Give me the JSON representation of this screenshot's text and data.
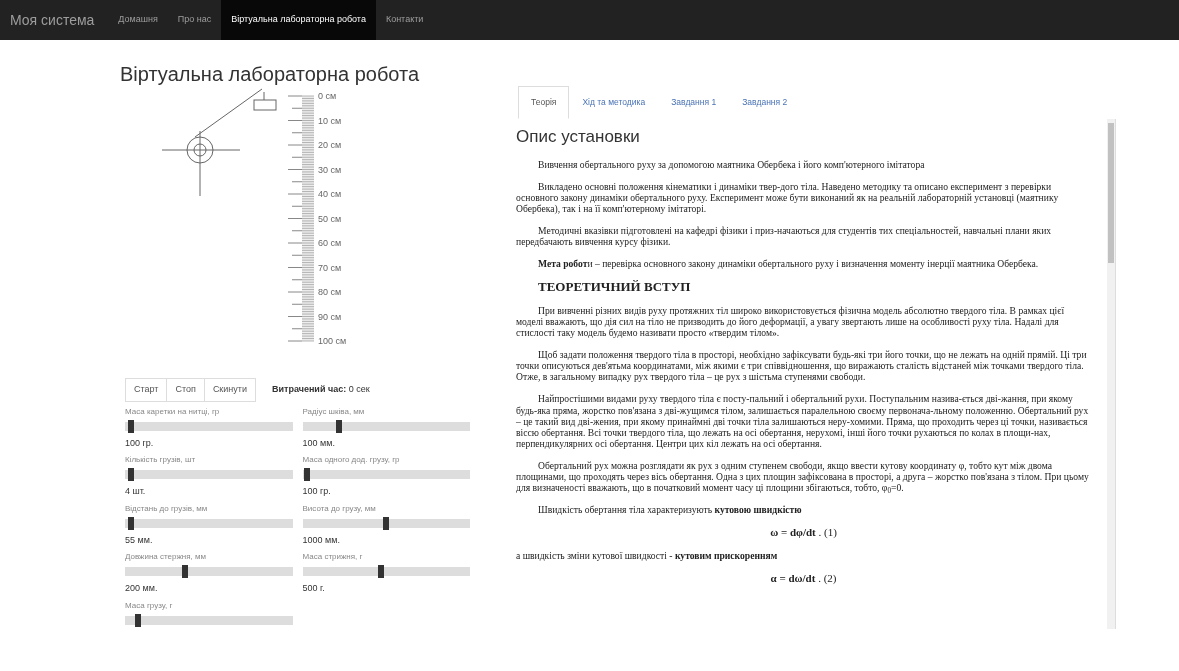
{
  "navbar": {
    "brand": "Моя система",
    "items": [
      {
        "label": "Домашня",
        "selected": false
      },
      {
        "label": "Про нас",
        "selected": false
      },
      {
        "label": "Віртуальна лабораторна робота",
        "selected": true
      },
      {
        "label": "Контакти",
        "selected": false
      }
    ]
  },
  "page_title": "Віртуальна лабораторна робота",
  "ruler": {
    "labels": [
      "0 см",
      "10 см",
      "20 см",
      "30 см",
      "40 см",
      "50 см",
      "60 см",
      "70 см",
      "80 см",
      "90 см",
      "100 см"
    ]
  },
  "controls": {
    "buttons": [
      "Старт",
      "Стоп",
      "Скинути"
    ],
    "time_label": "Витрачений час:",
    "time_value": "0 сек"
  },
  "sliders": [
    {
      "label": "Маса каретки на нитці, гр",
      "level": 0.02,
      "reading": "100 гр."
    },
    {
      "label": "Радіус шківа, мм",
      "level": 0.2,
      "reading": "100 мм."
    },
    {
      "label": "Кількість грузів, шт",
      "level": 0.02,
      "reading": "4 шт."
    },
    {
      "label": "Маса одного дод. грузу, гр",
      "level": 0.01,
      "reading": "100 гр."
    },
    {
      "label": "Відстань до грузів, мм",
      "level": 0.02,
      "reading": "55 мм."
    },
    {
      "label": "Висота до грузу, мм",
      "level": 0.48,
      "reading": "1000 мм."
    },
    {
      "label": "Довжина стержня, мм",
      "level": 0.34,
      "reading": "200 мм."
    },
    {
      "label": "Маса стрижня, г",
      "level": 0.45,
      "reading": "500 г."
    },
    {
      "label": "Маса грузу, г",
      "level": 0.06
    }
  ],
  "tabs": [
    {
      "label": "Теорія",
      "selected": true
    },
    {
      "label": "Хід та методика",
      "selected": false
    },
    {
      "label": "Завдання 1",
      "selected": false
    },
    {
      "label": "Завдання 2",
      "selected": false
    }
  ],
  "content": {
    "heading": "Опис установки",
    "blocks": [
      {
        "kind": "para",
        "text": "Вивчення обертального руху за допомогою маятника Обербека і його комп'ютерного імітатора"
      },
      {
        "kind": "para",
        "text": "Викладено основні положення кінематики і динаміки твер-дого тіла. Наведено методику та описано експеримент з перевірки основного закону динаміки обертального руху. Експеримент може бути виконаний як на реальній лабораторній установці (маятнику Обербека), так і на її комп'ютерному імітаторі."
      },
      {
        "kind": "para",
        "text": "Методичні вказівки підготовлені на кафедрі фізики і приз-начаються для студентів тих спеціальностей, навчальні плани яких передбачають вивчення курсу фізики."
      },
      {
        "kind": "para",
        "text": "**Мета робот**и – перевірка основного закону динаміки обертального руху і визначення моменту інерції маятника Обербека."
      },
      {
        "kind": "heading",
        "text": "ТЕОРЕТИЧНИЙ ВСТУП"
      },
      {
        "kind": "para",
        "text": "При вивченні різних видів руху протяжних тіл широко використовується фізична модель абсолютно твердого тіла. В рамках цієї моделі вважають, що дія сил на тіло не призводить до його деформації, а увагу звертають лише на особливості руху тіла. Надалі для стислості таку модель будемо називати просто «твердим тілом»."
      },
      {
        "kind": "para",
        "text": "Щоб задати положення твердого тіла в просторі, необхідно зафіксувати будь-які три його точки, що не лежать на одній прямій. Ці три точки описуються дев'ятьма координатами, між якими є три співвідношення, що виражають сталість відстаней між точками твердого тіла. Отже, в загальному випадку рух твердого тіла – це рух з шістьма ступенями свободи."
      },
      {
        "kind": "para",
        "text": "Найпростішими видами руху твердого тіла є посту-пальний і обертальний рухи. Поступальним назива-ється дві-жання, при якому будь-яка пряма, жорстко пов'язана з дві-жущимся тілом, залишається паралельною своєму первонача-льному положенню. Обертальний рух – це такий вид дві-жения, при якому принаймні дві точки тіла залишаються неру-хомими. Пряма, що проходить через ці точки, називається віссю обертання. Всі точки твердого тіла, що лежать на осі обертання, нерухомі, інші його точки рухаються по колах в площи-нах, перпендикулярних осі обертання. Центри цих кіл лежать на осі обертання."
      },
      {
        "kind": "para",
        "text": "Обертальний рух можна розглядати як рух з одним ступенем свободи, якщо ввести кутову координату φ, тобто кут між двома площинами, що проходять через вісь обертання. Одна з цих площин зафіксована в просторі, а друга – жорстко пов'язана з тілом. При цьому для визначеності вважають, що в початковий момент часу ці площини збігаються, тобто, φ$_{0}$=0."
      },
      {
        "kind": "para",
        "text": "Швидкість обертання тіла характеризують **кутовою швидкістю**"
      },
      {
        "kind": "equation",
        "text": "**ω = dφ/dt** . (1)"
      },
      {
        "kind": "plain",
        "text": "а швидкість зміни кутової швидкості - **кутовим прискоренням**"
      },
      {
        "kind": "equation",
        "text": "**α = dω/dt** . (2)"
      }
    ]
  }
}
